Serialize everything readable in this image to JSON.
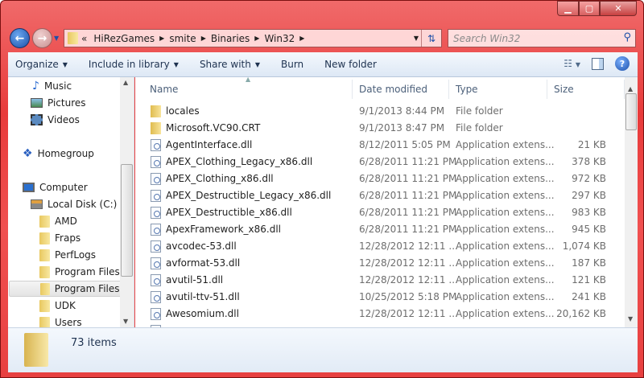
{
  "window": {
    "accent": "#e83a3a"
  },
  "address": {
    "overflow": "«",
    "segments": [
      "HiRezGames",
      "smite",
      "Binaries",
      "Win32"
    ]
  },
  "search": {
    "placeholder": "Search Win32"
  },
  "toolbar": {
    "organize": "Organize",
    "include": "Include in library",
    "share": "Share with",
    "burn": "Burn",
    "new_folder": "New folder"
  },
  "nav": {
    "items": [
      {
        "label": "Music",
        "icon": "music-icon"
      },
      {
        "label": "Pictures",
        "icon": "pictures-icon"
      },
      {
        "label": "Videos",
        "icon": "videos-icon"
      },
      {
        "label": "Homegroup",
        "icon": "homegroup-icon"
      },
      {
        "label": "Computer",
        "icon": "computer-icon"
      },
      {
        "label": "Local Disk (C:)",
        "icon": "drive-icon"
      },
      {
        "label": "AMD",
        "icon": "folder-icon"
      },
      {
        "label": "Fraps",
        "icon": "folder-icon"
      },
      {
        "label": "PerfLogs",
        "icon": "folder-icon"
      },
      {
        "label": "Program Files",
        "icon": "folder-icon"
      },
      {
        "label": "Program Files (",
        "icon": "folder-icon",
        "selected": true
      },
      {
        "label": "UDK",
        "icon": "folder-icon"
      },
      {
        "label": "Users",
        "icon": "folder-icon"
      }
    ]
  },
  "columns": {
    "name": "Name",
    "date": "Date modified",
    "type": "Type",
    "size": "Size"
  },
  "files": [
    {
      "name": "locales",
      "date": "9/1/2013 8:44 PM",
      "type": "File folder",
      "size": "",
      "kind": "folder"
    },
    {
      "name": "Microsoft.VC90.CRT",
      "date": "9/1/2013 8:47 PM",
      "type": "File folder",
      "size": "",
      "kind": "folder"
    },
    {
      "name": "AgentInterface.dll",
      "date": "8/12/2011 5:05 PM",
      "type": "Application extens...",
      "size": "21 KB",
      "kind": "dll"
    },
    {
      "name": "APEX_Clothing_Legacy_x86.dll",
      "date": "6/28/2011 11:21 PM",
      "type": "Application extens...",
      "size": "378 KB",
      "kind": "dll"
    },
    {
      "name": "APEX_Clothing_x86.dll",
      "date": "6/28/2011 11:21 PM",
      "type": "Application extens...",
      "size": "972 KB",
      "kind": "dll"
    },
    {
      "name": "APEX_Destructible_Legacy_x86.dll",
      "date": "6/28/2011 11:21 PM",
      "type": "Application extens...",
      "size": "297 KB",
      "kind": "dll"
    },
    {
      "name": "APEX_Destructible_x86.dll",
      "date": "6/28/2011 11:21 PM",
      "type": "Application extens...",
      "size": "983 KB",
      "kind": "dll"
    },
    {
      "name": "ApexFramework_x86.dll",
      "date": "6/28/2011 11:21 PM",
      "type": "Application extens...",
      "size": "945 KB",
      "kind": "dll"
    },
    {
      "name": "avcodec-53.dll",
      "date": "12/28/2012 12:11 ...",
      "type": "Application extens...",
      "size": "1,074 KB",
      "kind": "dll"
    },
    {
      "name": "avformat-53.dll",
      "date": "12/28/2012 12:11 ...",
      "type": "Application extens...",
      "size": "187 KB",
      "kind": "dll"
    },
    {
      "name": "avutil-51.dll",
      "date": "12/28/2012 12:11 ...",
      "type": "Application extens...",
      "size": "121 KB",
      "kind": "dll"
    },
    {
      "name": "avutil-ttv-51.dll",
      "date": "10/25/2012 5:18 PM",
      "type": "Application extens...",
      "size": "241 KB",
      "kind": "dll"
    },
    {
      "name": "Awesomium.dll",
      "date": "12/28/2012 12:11 ...",
      "type": "Application extens...",
      "size": "20,162 KB",
      "kind": "dll"
    }
  ],
  "status": {
    "count": "73 items"
  }
}
